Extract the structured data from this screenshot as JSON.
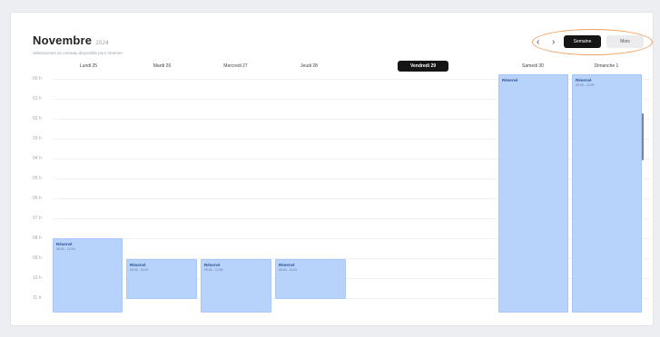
{
  "header": {
    "month": "Novembre",
    "year": "2024",
    "subtitle": "Sélectionnez un créneau disponible pour réserver"
  },
  "nav": {
    "prev": "‹",
    "next": "›",
    "week_label": "Semaine",
    "month_label": "Mois"
  },
  "days": [
    {
      "label": "Lundi 25",
      "today": false
    },
    {
      "label": "Mardi 26",
      "today": false
    },
    {
      "label": "Mercredi 27",
      "today": false
    },
    {
      "label": "Jeudi 28",
      "today": false
    },
    {
      "label": "Vendredi 29",
      "today": true
    },
    {
      "label": "Samedi 30",
      "today": false
    },
    {
      "label": "Dimanche 1",
      "today": false
    }
  ],
  "hours": [
    "00 h",
    "01 h",
    "02 h",
    "03 h",
    "04 h",
    "05 h",
    "06 h",
    "07 h",
    "08 h",
    "09 h",
    "10 h",
    "11 h"
  ],
  "events": [
    {
      "day": "Lundi 25",
      "title": "Réservé",
      "time": "08:00 - 12:00"
    },
    {
      "day": "Mardi 26",
      "title": "Réservé",
      "time": "09:00 - 11:00"
    },
    {
      "day": "Mercredi 27",
      "title": "Réservé",
      "time": "09:00 - 12:00"
    },
    {
      "day": "Jeudi 28",
      "title": "Réservé",
      "time": "09:00 - 11:00"
    },
    {
      "day": "Samedi 30",
      "title": "Réservé",
      "time": ""
    },
    {
      "day": "Dimanche 1",
      "title": "Réservé",
      "time": "00:00 - 12:00"
    }
  ],
  "colors": {
    "event_fill": "#b7d2fb",
    "event_text": "#2a4f8f",
    "today_bg": "#151515",
    "highlight": "#f0a060"
  }
}
